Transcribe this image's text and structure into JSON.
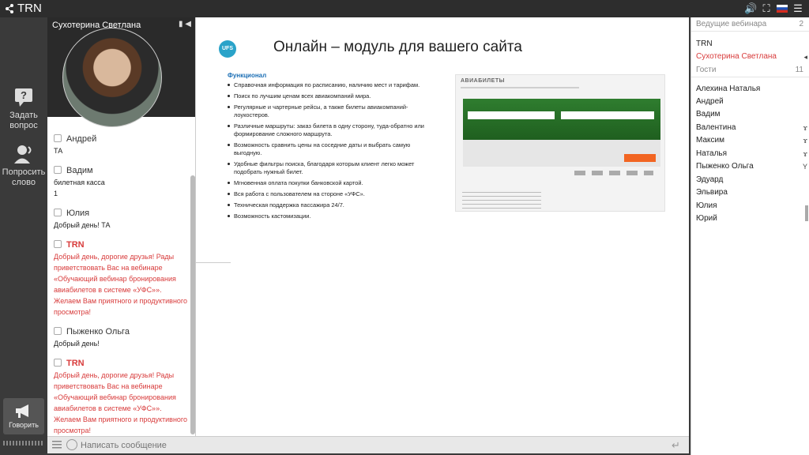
{
  "app": {
    "title": "TRN"
  },
  "topbar": {
    "icons": [
      "volume-icon",
      "fullscreen-icon",
      "flag-ru-icon",
      "menu-icon"
    ]
  },
  "rail": {
    "ask": "Задать вопрос",
    "request_word": "Попросить слово",
    "speak": "Говорить"
  },
  "video": {
    "name": "Сухотерина Светлана"
  },
  "chat": {
    "messages": [
      {
        "author": "Андрей",
        "text": "ТА"
      },
      {
        "author": "Вадим",
        "text": "билетная касса\n1"
      },
      {
        "author": "Юлия",
        "text": "Добрый день! ТА"
      },
      {
        "author": "TRN",
        "text": "Добрый день, дорогие друзья! Рады приветствовать Вас на вебинаре «Обучающий вебинар бронирования авиабилетов в системе «УФС»». Желаем Вам приятного и продуктивного просмотра!"
      },
      {
        "author": "Пыженко Ольга",
        "text": "Добрый день!"
      },
      {
        "author": "TRN",
        "text": "Добрый день, дорогие друзья! Рады приветствовать Вас на вебинаре «Обучающий вебинар бронирования авиабилетов в системе «УФС»». Желаем Вам приятного и продуктивного просмотра!"
      }
    ],
    "input_placeholder": "Написать сообщение"
  },
  "slide": {
    "logo": "UFS",
    "title": "Онлайн – модуль для вашего сайта",
    "features_heading": "Функционал",
    "features": [
      "Справочная информация по расписанию, наличию мест и тарифам.",
      "Поиск по лучшим ценам всех авиакомпаний мира.",
      "Регулярные и чартерные рейсы, а также билеты авиакомпаний-лоукостеров.",
      "Различные маршруты: заказ билета в одну сторону, туда-обратно или формирование сложного маршрута.",
      "Возможность сравнить цены на соседние даты и выбрать самую выгодную.",
      "Удобные фильтры поиска, благодаря которым клиент легко может подобрать нужный билет.",
      "Мгновенная оплата покупки банковской картой.",
      "Вся работа с пользователем на стороне «УФС».",
      "Техническая поддержка пассажира 24/7.",
      "Возможность кастомизации."
    ],
    "mock_heading": "АВИАБИЛЕТЫ"
  },
  "participants": {
    "hosts_label": "Ведущие вебинара",
    "hosts_count": "2",
    "hosts": [
      "TRN",
      "Сухотерина Светлана"
    ],
    "guests_label": "Гости",
    "guests_count": "11",
    "guests": [
      "Алехина Наталья",
      "Андрей",
      "Вадим",
      "Валентина",
      "Максим",
      "Наталья",
      "Пыженко Ольга",
      "Эдуард",
      "Эльвира",
      "Юлия",
      "Юрий"
    ]
  }
}
